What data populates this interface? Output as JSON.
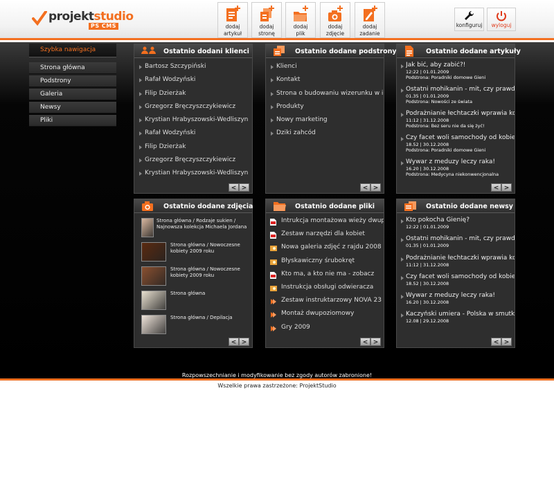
{
  "header": {
    "logo_part1": "projekt",
    "logo_part2": "studio",
    "logo_badge": "PS CMS",
    "tools": [
      {
        "l1": "dodaj",
        "l2": "artykuł",
        "icon": "add-article-icon"
      },
      {
        "l1": "dodaj",
        "l2": "stronę",
        "icon": "add-page-icon"
      },
      {
        "l1": "dodaj",
        "l2": "plik",
        "icon": "add-file-icon"
      },
      {
        "l1": "dodaj",
        "l2": "zdjęcie",
        "icon": "add-photo-icon"
      },
      {
        "l1": "dodaj",
        "l2": "zadanie",
        "icon": "add-task-icon"
      }
    ],
    "configure": "konfiguruj",
    "logout": "wyloguj"
  },
  "sidebar": {
    "title": "Szybka nawigacja",
    "items": [
      "Strona główna",
      "Podstrony",
      "Galeria",
      "Newsy",
      "Pliki"
    ]
  },
  "panels": {
    "clients": {
      "title": "Ostatnio dodani klienci",
      "items": [
        "Bartosz Szczypiński",
        "Rafał Wodzyński",
        "Filip Dzierżak",
        "Grzegorz Bręczyszczykiewicz",
        "Krystian Hrabyszowski-Wedliszyn",
        "Rafał Wodzyński",
        "Filip Dzierżak",
        "Grzegorz Bręczyszczykiewicz",
        "Krystian Hrabyszowski-Wedliszyn"
      ]
    },
    "pages": {
      "title": "Ostatnio dodane podstrony",
      "items": [
        "Klienci",
        "Kontakt",
        "Strona o budowaniu wizerunku w i...",
        "Produkty",
        "Nowy marketing",
        "Dziki zahcód"
      ]
    },
    "articles": {
      "title": "Ostatnio dodane artykuły",
      "items": [
        {
          "title": "Jak bić, aby zabić?!",
          "meta": "12:22 | 01.01.2009",
          "sub": "Podstrona: Poradniki domowe Gieni"
        },
        {
          "title": "Ostatni mohikanin - mit, czy prawda?",
          "meta": "01.35 | 01.01.2009",
          "sub": "Podstrona: Nowości ze świata"
        },
        {
          "title": "Podrażnianie łechtaczki wprawia ko...",
          "meta": "11:12 | 31.12.2008",
          "sub": "Podstrona: Bez seru nie da się żyć!"
        },
        {
          "title": "Czy facet woli samochody od kobiet?",
          "meta": "18.52 | 30.12.2008",
          "sub": "Podstrona: Poradniki domowe Gieni"
        },
        {
          "title": "Wywar z meduzy leczy raka!",
          "meta": "16.20 | 30.12.2008",
          "sub": "Podstrona: Medycyna niekonwencjonalna"
        }
      ]
    },
    "photos": {
      "title": "Ostatnio dodane zdjęcia",
      "items": [
        {
          "cap1": "Strona główna / Rodzaje sukien /",
          "cap2": "Najnowsza kolekcja Michaela Jordana",
          "color": "#d9b8a0"
        },
        {
          "cap1": "Strona główna / Nowoczesne",
          "cap2": "kobiety 2009 roku",
          "color": "#5a2a10"
        },
        {
          "cap1": "Strona główna / Nowoczesne",
          "cap2": "kobiety 2009 roku",
          "color": "#8a5030"
        },
        {
          "cap1": "Strona główna",
          "cap2": "",
          "color": "#e8e0d0"
        },
        {
          "cap1": "Strona główna / Depilacja",
          "cap2": "",
          "color": "#efe4da"
        }
      ]
    },
    "files": {
      "title": "Ostatnio dodane pliki",
      "items": [
        {
          "name": "Intrukcja montażowa wieży dwupo...",
          "type": "pdf"
        },
        {
          "name": "Zestaw narzędzi dla kobiet",
          "type": "pdf"
        },
        {
          "name": "Nowa galeria zdjęć z rajdu 2008",
          "type": "img"
        },
        {
          "name": "Błyskawiczny śrubokręt",
          "type": "img"
        },
        {
          "name": "Kto ma, a kto nie ma - zobacz",
          "type": "pdf"
        },
        {
          "name": "Instrukcja obsługi odwieracza",
          "type": "img"
        },
        {
          "name": "Zestaw instruktarzowy NOVA 23",
          "type": "media"
        },
        {
          "name": "Montaż dwupoziomowy",
          "type": "media"
        },
        {
          "name": "Gry 2009",
          "type": "media"
        }
      ]
    },
    "news": {
      "title": "Ostatnio dodane newsy",
      "items": [
        {
          "title": "Kto pokocha Gienię?",
          "meta": "12:22 | 01.01.2009"
        },
        {
          "title": "Ostatni mohikanin - mit, czy prawda?",
          "meta": "01.35 | 01.01.2009"
        },
        {
          "title": "Podrażnianie łechtaczki wprawia ko...",
          "meta": "11:12 | 31.12.2008"
        },
        {
          "title": "Czy facet woli samochody od kobiet?",
          "meta": "18.52 | 30.12.2008"
        },
        {
          "title": "Wywar z meduzy leczy raka!",
          "meta": "16.20 | 30.12.2008"
        },
        {
          "title": "Kaczyński umiera - Polska w smutku!",
          "meta": "12.08 | 29.12.2008"
        }
      ]
    }
  },
  "pager": {
    "prev": "<",
    "next": ">"
  },
  "footer": {
    "notice": "Rozpowszechnianie i modyfikowanie bez zgody autorów zabronione!",
    "rights": "Wszelkie prawa zastrzeżone: ProjektStudio"
  },
  "colors": {
    "accent": "#f36f1f",
    "panel": "#2e2e2e",
    "background": "#000000"
  }
}
